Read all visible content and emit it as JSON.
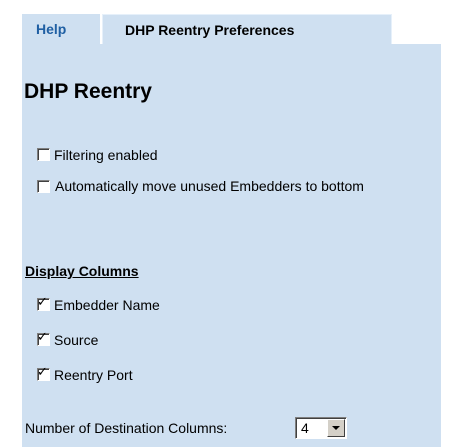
{
  "tabs": [
    {
      "label": "Help"
    },
    {
      "label": "DHP Reentry Preferences"
    }
  ],
  "colors": {
    "panel_bg": "#cfe0f1",
    "help_tab_text": "#1f5fa3"
  },
  "panel": {
    "title": "DHP Reentry",
    "options": [
      {
        "label": "Filtering enabled",
        "checked": false
      },
      {
        "label": "Automatically move unused Embedders to bottom",
        "checked": false
      }
    ],
    "display_columns": {
      "heading": "Display Columns",
      "items": [
        {
          "label": "Embedder Name",
          "checked": true
        },
        {
          "label": "Source",
          "checked": true
        },
        {
          "label": "Reentry Port",
          "checked": true
        }
      ]
    },
    "destination_columns": {
      "label": "Number of Destination Columns:",
      "value": "4"
    }
  },
  "icons": {
    "checkmark": "✓",
    "dropdown": "chevron-down-icon"
  }
}
